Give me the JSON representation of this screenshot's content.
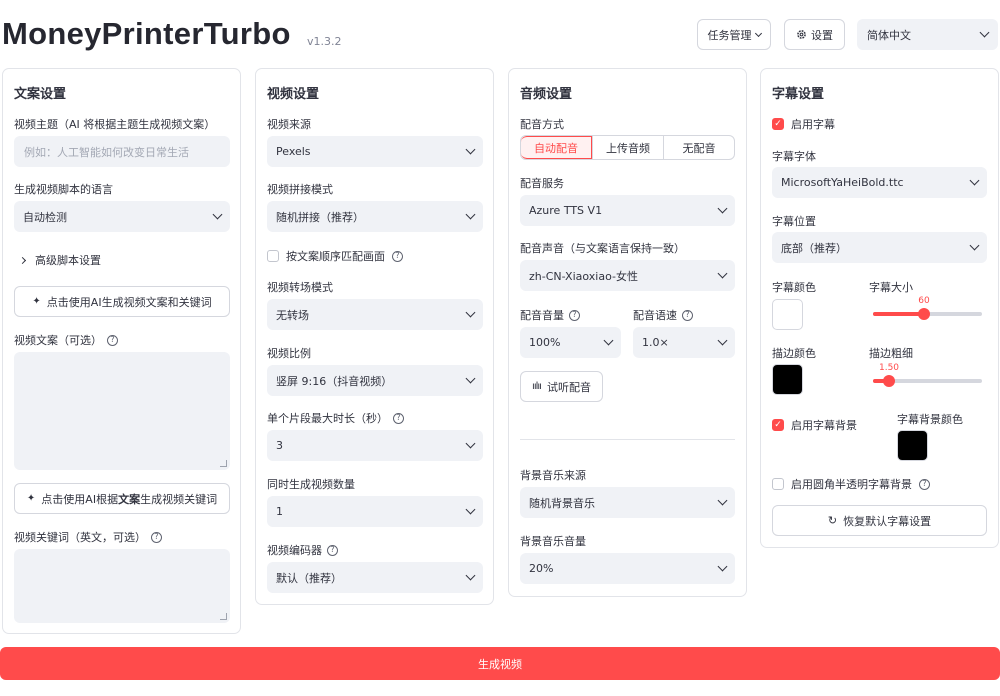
{
  "header": {
    "title": "MoneyPrinterTurbo",
    "version": "v1.3.2",
    "task_button": "任务管理",
    "settings_button": "设置",
    "language_value": "简体中文"
  },
  "script_panel": {
    "title": "文案设置",
    "subject_label": "视频主题（AI 将根据主题生成视频文案）",
    "subject_placeholder": "例如：人工智能如何改变日常生活",
    "language_label": "生成视频脚本的语言",
    "language_value": "自动检测",
    "advanced_label": "高级脚本设置",
    "ai_generate_button": "点击使用AI生成视频文案和关键词",
    "script_label": "视频文案（可选）",
    "kw_button_prefix": "点击使用AI根据",
    "kw_button_bold": "文案",
    "kw_button_suffix": "生成视频关键词",
    "keywords_label": "视频关键词（英文，可选）"
  },
  "video_panel": {
    "title": "视频设置",
    "source_label": "视频来源",
    "source_value": "Pexels",
    "concat_label": "视频拼接模式",
    "concat_value": "随机拼接（推荐）",
    "match_order_label": "按文案顺序匹配画面",
    "transition_label": "视频转场模式",
    "transition_value": "无转场",
    "ratio_label": "视频比例",
    "ratio_value": "竖屏 9:16（抖音视频）",
    "clip_duration_label": "单个片段最大时长（秒）",
    "clip_duration_value": "3",
    "count_label": "同时生成视频数量",
    "count_value": "1",
    "codec_label": "视频编码器",
    "codec_value": "默认（推荐）"
  },
  "audio_panel": {
    "title": "音频设置",
    "mode_label": "配音方式",
    "mode_options": [
      "自动配音",
      "上传音频",
      "无配音"
    ],
    "service_label": "配音服务",
    "service_value": "Azure TTS V1",
    "voice_label": "配音声音（与文案语言保持一致）",
    "voice_value": "zh-CN-Xiaoxiao-女性",
    "volume_label": "配音音量",
    "volume_value": "100%",
    "speed_label": "配音语速",
    "speed_value": "1.0×",
    "preview_button": "试听配音",
    "bgm_source_label": "背景音乐来源",
    "bgm_source_value": "随机背景音乐",
    "bgm_volume_label": "背景音乐音量",
    "bgm_volume_value": "20%"
  },
  "subtitle_panel": {
    "title": "字幕设置",
    "enable_label": "启用字幕",
    "font_label": "字幕字体",
    "font_value": "MicrosoftYaHeiBold.ttc",
    "position_label": "字幕位置",
    "position_value": "底部（推荐）",
    "color_label": "字幕颜色",
    "color_value": "#ffffff",
    "size_label": "字幕大小",
    "size_value": "60",
    "size_fraction": 0.47,
    "stroke_color_label": "描边颜色",
    "stroke_color_value": "#000000",
    "stroke_width_label": "描边粗细",
    "stroke_width_value": "1.50",
    "stroke_fraction": 0.15,
    "bg_enable_label": "启用字幕背景",
    "bg_color_label": "字幕背景颜色",
    "bg_color_value": "#000000",
    "rounded_bg_label": "启用圆角半透明字幕背景",
    "reset_button": "恢复默认字幕设置"
  },
  "generate_button": "生成视频",
  "colors": {
    "accent": "#ff4b4b",
    "input_bg": "#f0f2f6"
  }
}
